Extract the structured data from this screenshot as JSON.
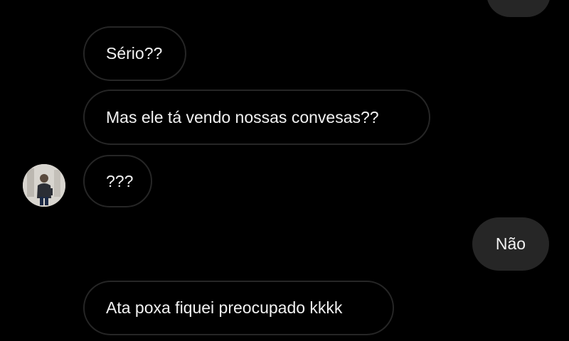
{
  "colors": {
    "background": "#000000",
    "incoming_border": "#262626",
    "outgoing_bubble": "#262626",
    "text": "#f2f2f2"
  },
  "contact": {
    "avatar_icon": "profile-photo-avatar"
  },
  "messages": [
    {
      "direction": "outgoing",
      "text": ""
    },
    {
      "direction": "incoming",
      "text": "Sério??"
    },
    {
      "direction": "incoming",
      "text": "Mas ele tá vendo nossas convesas??"
    },
    {
      "direction": "incoming",
      "text": "???"
    },
    {
      "direction": "outgoing",
      "text": "Não"
    },
    {
      "direction": "incoming",
      "text": "Ata poxa fiquei preocupado kkkk"
    }
  ]
}
